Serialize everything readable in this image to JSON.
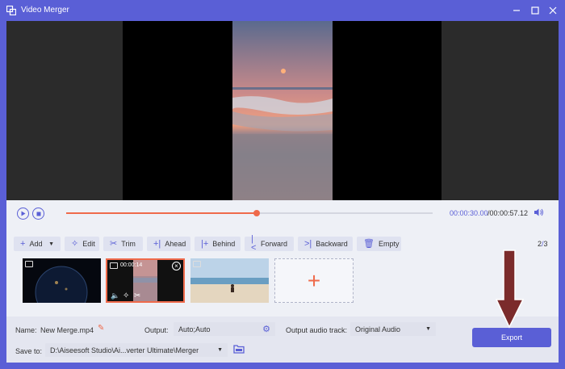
{
  "window": {
    "title": "Video Merger"
  },
  "playback": {
    "current_time": "00:00:30.00",
    "total_time": "/00:00:57.12",
    "progress": 0.52
  },
  "toolbar": {
    "add": "Add",
    "edit": "Edit",
    "trim": "Trim",
    "ahead": "Ahead",
    "behind": "Behind",
    "forward": "Forward",
    "backward": "Backward",
    "empty": "Empty",
    "count_current": "2",
    "count_sep": "/",
    "count_total": "3"
  },
  "clips": [
    {
      "type": "earth-night"
    },
    {
      "type": "sunset-beach",
      "duration": "00:00:14",
      "selected": true
    },
    {
      "type": "beach-person"
    }
  ],
  "settings": {
    "name_label": "Name:",
    "name_value": "New Merge.mp4",
    "output_label": "Output:",
    "output_value": "Auto;Auto",
    "audio_label": "Output audio track:",
    "audio_value": "Original Audio",
    "save_label": "Save to:",
    "save_value": "D:\\Aiseesoft Studio\\Ai...verter Ultimate\\Merger"
  },
  "export": {
    "label": "Export"
  },
  "colors": {
    "accent": "#5a5fd6",
    "progress": "#ef6a4b",
    "annotation_arrow": "#7b2b2b"
  }
}
